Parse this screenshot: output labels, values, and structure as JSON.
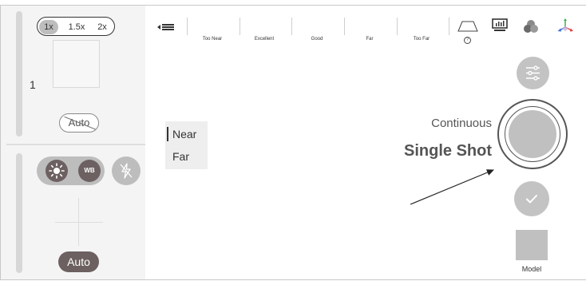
{
  "zoom": {
    "options": [
      "1x",
      "1.5x",
      "2x"
    ],
    "selected": "1x",
    "level": "1"
  },
  "left_panel": {
    "focus_mode_label": "Auto",
    "exposure_icon": "sun-icon",
    "white_balance_label": "WB",
    "flash_icon": "flash-off-icon",
    "exposure_mode_label": "Auto"
  },
  "toolbar": {
    "back_icon": "collapse-menu-icon",
    "distance_labels": [
      "Too Near",
      "Excellent",
      "Good",
      "Far",
      "Too Far"
    ],
    "icons": [
      "shape-outline-icon",
      "histogram-icon",
      "color-channels-icon",
      "axes-3d-icon"
    ],
    "help_label": "?"
  },
  "focus_list": {
    "items": [
      "Near",
      "Far"
    ],
    "active": "Near"
  },
  "capture": {
    "mode_continuous": "Continuous",
    "mode_single": "Single Shot",
    "settings_icon": "sliders-icon",
    "confirm_icon": "check-icon",
    "model_label": "Model"
  },
  "colors": {
    "panel_bg": "#f4f4f4",
    "pill_gray": "#bdbdbd",
    "dark_button": "#6c6060",
    "text": "#333333"
  }
}
